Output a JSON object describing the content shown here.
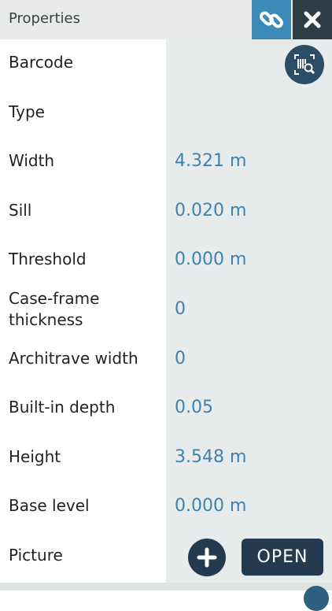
{
  "header": {
    "title": "Properties"
  },
  "icons": {
    "link": "link-icon",
    "close": "close-icon",
    "barcode": "barcode-scan-icon",
    "plus": "plus-icon"
  },
  "colors": {
    "accent": "#3b8ab8",
    "dark_button": "#243b4f",
    "value_text": "#3f82ad",
    "value_column": "#e8ebeb"
  },
  "properties": [
    {
      "label": "Barcode",
      "value": ""
    },
    {
      "label": "Type",
      "value": ""
    },
    {
      "label": "Width",
      "value": "4.321 m"
    },
    {
      "label": "Sill",
      "value": "0.020 m"
    },
    {
      "label": "Threshold",
      "value": "0.000 m"
    },
    {
      "label": "Case-frame thickness",
      "value": "0"
    },
    {
      "label": "Architrave width",
      "value": "0"
    },
    {
      "label": "Built-in depth",
      "value": "0.05"
    },
    {
      "label": "Height",
      "value": "3.548 m"
    },
    {
      "label": "Base level",
      "value": "0.000 m"
    },
    {
      "label": "Picture",
      "value": ""
    }
  ],
  "buttons": {
    "open_label": "OPEN"
  }
}
